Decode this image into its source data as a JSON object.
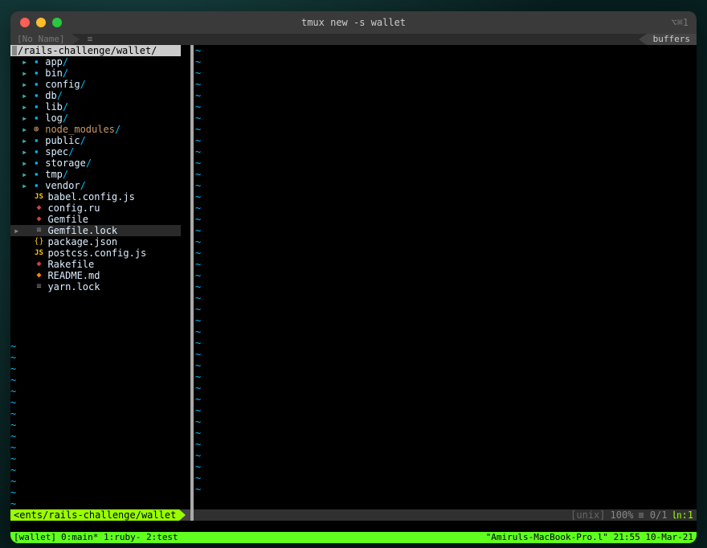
{
  "title": "tmux new -s wallet",
  "title_right": "⌥⌘1",
  "tab": {
    "noname": "[No Name]",
    "hamb": "≡",
    "buffers": "buffers"
  },
  "tree": {
    "path": "/rails-challenge/wallet/",
    "items": [
      {
        "type": "dir",
        "name": "app",
        "sel": false
      },
      {
        "type": "dir",
        "name": "bin",
        "sel": false
      },
      {
        "type": "dir",
        "name": "config",
        "sel": false
      },
      {
        "type": "dir",
        "name": "db",
        "sel": false
      },
      {
        "type": "dir",
        "name": "lib",
        "sel": false
      },
      {
        "type": "dir",
        "name": "log",
        "sel": false
      },
      {
        "type": "dir",
        "name": "node_modules",
        "sel": false,
        "icon": "dim"
      },
      {
        "type": "dir",
        "name": "public",
        "sel": false
      },
      {
        "type": "dir",
        "name": "spec",
        "sel": false
      },
      {
        "type": "dir",
        "name": "storage",
        "sel": false
      },
      {
        "type": "dir",
        "name": "tmp",
        "sel": false
      },
      {
        "type": "dir",
        "name": "vendor",
        "sel": false
      },
      {
        "type": "file",
        "name": "babel.config.js",
        "icon": "js"
      },
      {
        "type": "file",
        "name": "config.ru",
        "icon": "rb"
      },
      {
        "type": "file",
        "name": "Gemfile",
        "icon": "rb"
      },
      {
        "type": "file",
        "name": "Gemfile.lock",
        "icon": "gr",
        "sel": true
      },
      {
        "type": "file",
        "name": "package.json",
        "icon": "jn"
      },
      {
        "type": "file",
        "name": "postcss.config.js",
        "icon": "js"
      },
      {
        "type": "file",
        "name": "Rakefile",
        "icon": "rb"
      },
      {
        "type": "file",
        "name": "README.md",
        "icon": "md"
      },
      {
        "type": "file",
        "name": "yarn.lock",
        "icon": "gr"
      }
    ]
  },
  "status": {
    "left_path": "<ents/rails-challenge/wallet",
    "unix": "[unix]",
    "pct": "100%",
    "lines": "≡ 0/1",
    "col": "㏑:1"
  },
  "tmux": {
    "session": "[wallet]",
    "wins": "0:main* 1:ruby- 2:test",
    "host": "\"Amiruls-MacBook-Pro.l\"",
    "time": "21:55",
    "date": "10-Mar-21"
  },
  "icons": {
    "folder": "▇",
    "ring": "⊛",
    "arrow": "▸",
    "arrow_sel": "▸",
    "js": "JS",
    "rb": "◆",
    "gr": "≡",
    "jn": "{}",
    "md": "◆"
  }
}
